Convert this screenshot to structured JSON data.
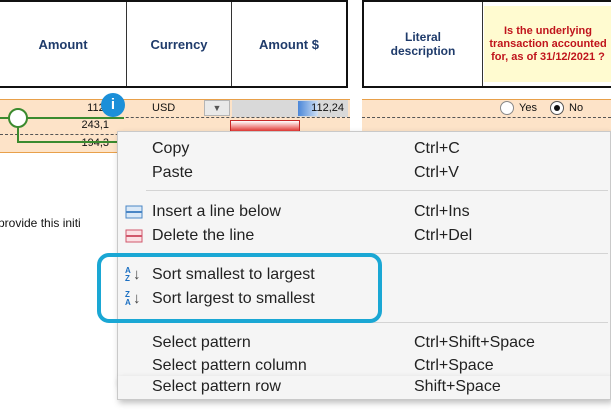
{
  "header": {
    "amount": "Amount",
    "currency": "Currency",
    "amount_usd": "Amount $",
    "literal_description": "Literal description",
    "question": "Is the underlying transaction accounted for, as of 31/12/2021 ?"
  },
  "rows": [
    {
      "amount": "112,24",
      "currency": "USD",
      "amount_usd": "112,24",
      "yes": "Yes",
      "no": "No"
    },
    {
      "amount": "243,1"
    },
    {
      "amount": "194,3"
    }
  ],
  "info_badge": "i",
  "side_text": "provide this initi",
  "menu": {
    "items": [
      {
        "label": "Copy",
        "shortcut": "Ctrl+C"
      },
      {
        "label": "Paste",
        "shortcut": "Ctrl+V"
      },
      {
        "label": "Insert a line below",
        "shortcut": "Ctrl+Ins",
        "icon": "insert-line-icon"
      },
      {
        "label": "Delete the line",
        "shortcut": "Ctrl+Del",
        "icon": "delete-line-icon"
      },
      {
        "label": "Sort smallest to largest",
        "shortcut": "",
        "icon": "sort-ascending-icon"
      },
      {
        "label": "Sort largest to smallest",
        "shortcut": "",
        "icon": "sort-descending-icon"
      },
      {
        "label": "Select pattern",
        "shortcut": "Ctrl+Shift+Space"
      },
      {
        "label": "Select pattern column",
        "shortcut": "Ctrl+Space"
      },
      {
        "label": "Select pattern row",
        "shortcut": "Shift+Space"
      }
    ],
    "sort_icon_glyphs": {
      "az_top": "A",
      "az_bottom": "Z",
      "za_top": "Z",
      "za_bottom": "A"
    }
  },
  "colors": {
    "row_fill": "#fde3c8",
    "row_line": "#e8a04a",
    "highlight": "#1aa7d4",
    "info_badge": "#1b8fd8",
    "connector": "#3b8a2e",
    "header_text": "#1f3b6b",
    "question_text": "#c0141c",
    "question_fill": "#fffbd0"
  }
}
